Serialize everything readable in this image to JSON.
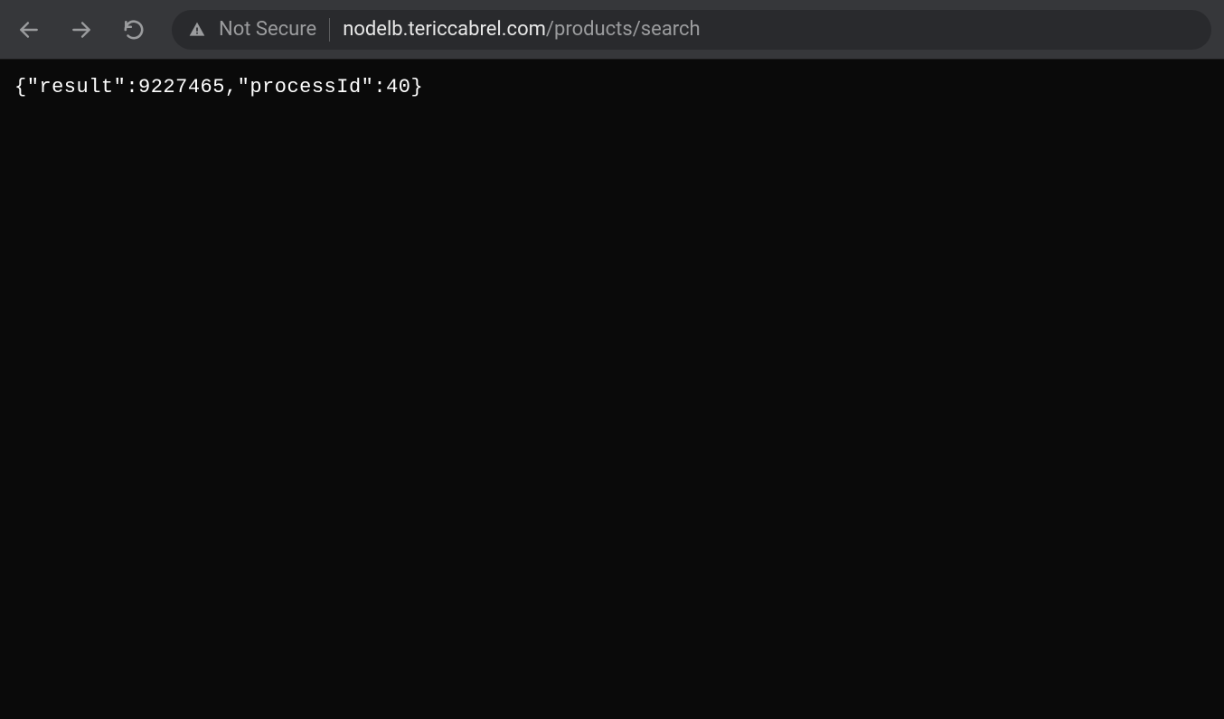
{
  "toolbar": {
    "not_secure_label": "Not Secure",
    "url_host": "nodelb.tericcabrel.com",
    "url_path": "/products/search"
  },
  "page": {
    "body_text": "{\"result\":9227465,\"processId\":40}"
  }
}
